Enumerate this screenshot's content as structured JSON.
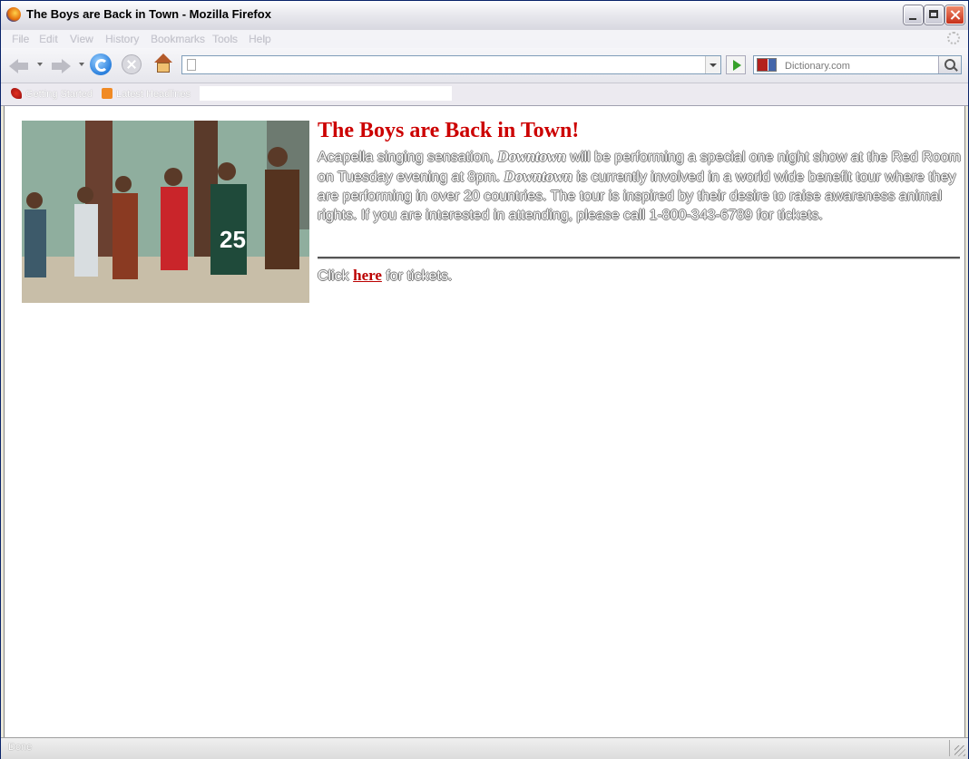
{
  "window": {
    "title": "The Boys are Back in Town - Mozilla Firefox"
  },
  "menu": [
    "File",
    "Edit",
    "View",
    "History",
    "Bookmarks",
    "Tools",
    "Help"
  ],
  "navigation": {
    "url_value": "",
    "search_placeholder": "Dictionary.com",
    "search_engine_icon": "dictionary-icon"
  },
  "bookmarks": {
    "items": [
      {
        "label": "Getting Started",
        "icon": "firefox-icon"
      },
      {
        "label": "Latest Headlines",
        "icon": "rss-feed-icon"
      }
    ]
  },
  "page": {
    "headline": "The Boys are Back in Town!",
    "paragraph": {
      "part1": "Acapella singing sensation, ",
      "group1": "Downtown",
      "part2": " will be performing a special one night show at the Red Room on Tuesday evening at 8pm. ",
      "group2": "Downtown",
      "part3": " is currently involved in a world wide benefit tour where they are performing in over 20 countries. The tour is inspired by their desire to raise awareness animal rights. If you are interested in attending, please call 1-800-343-6789 for tickets."
    },
    "tickets": {
      "prefix": "Click ",
      "link": "here",
      "suffix": " for tickets."
    }
  },
  "status": {
    "text": "Done"
  },
  "colors": {
    "headline": "#cc0000",
    "link": "#bb0000"
  }
}
